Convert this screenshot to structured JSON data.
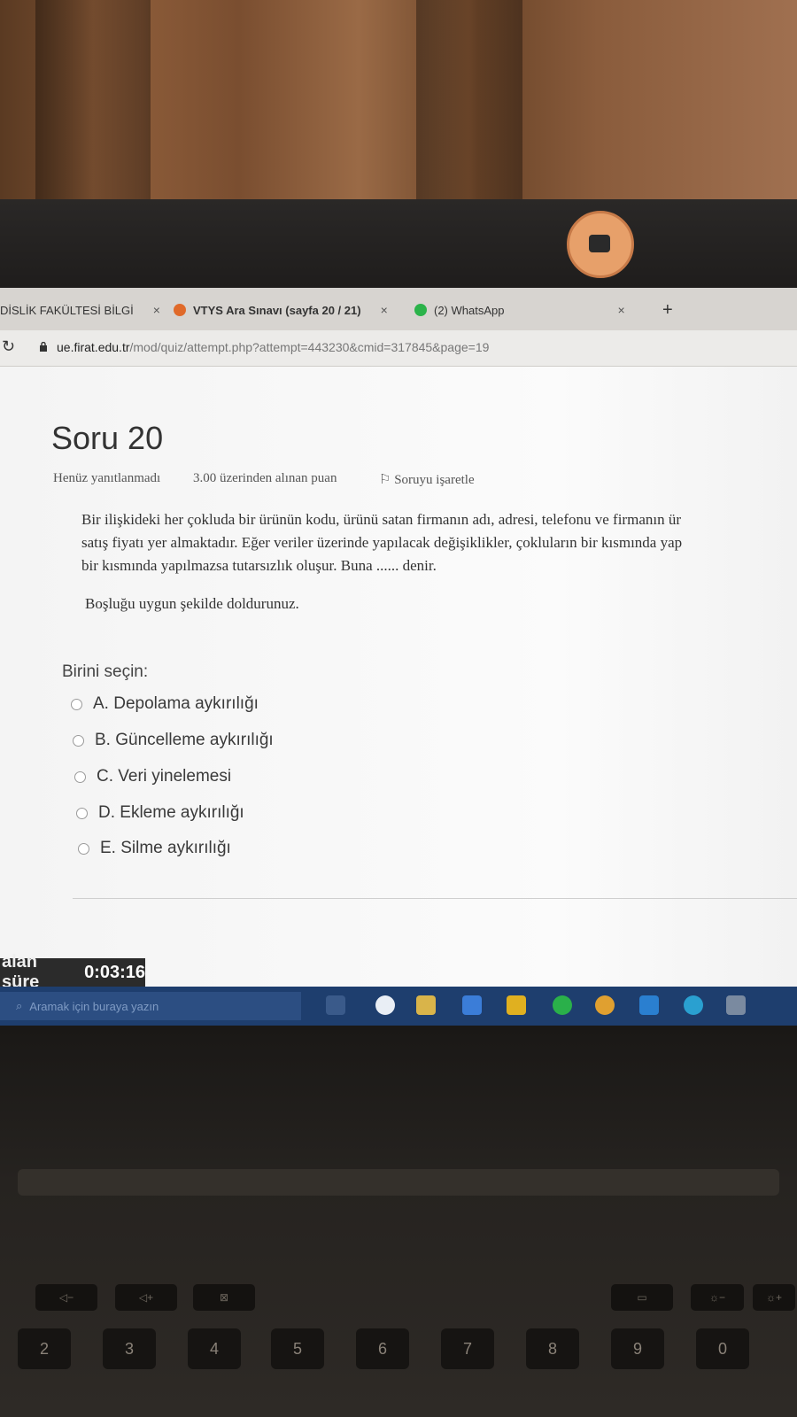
{
  "browser": {
    "tabs": [
      {
        "label": "DİSLİK FAKÜLTESİ BİLGİ",
        "close": "×"
      },
      {
        "label": "VTYS Ara Sınavı (sayfa 20 / 21)",
        "close": "×"
      },
      {
        "label": "(2) WhatsApp",
        "close": "×"
      }
    ],
    "new_tab": "+",
    "url_host": "ue.firat.edu.tr",
    "url_path": "/mod/quiz/attempt.php?attempt=443230&cmid=317845&page=19"
  },
  "question": {
    "title": "Soru 20",
    "status": "Henüz yanıtlanmadı",
    "points": "3.00 üzerinden alınan puan",
    "flag": "Soruyu işaretle",
    "text_lines": [
      "Bir ilişkideki her çokluda bir ürünün kodu, ürünü satan firmanın adı, adresi, telefonu ve firmanın ür",
      "satış fiyatı yer almaktadır. Eğer veriler üzerinde yapılacak değişiklikler, çokluların bir kısmında yap",
      "bir kısmında yapılmazsa tutarsızlık oluşur. Buna ...... denir."
    ],
    "prompt": "Boşluğu uygun şekilde doldurunuz.",
    "choose_label": "Birini seçin:",
    "options": [
      "A. Depolama aykırılığı",
      "B. Güncelleme aykırılığı",
      "C. Veri yinelemesi",
      "D. Ekleme aykırılığı",
      "E. Silme aykırılığı"
    ]
  },
  "timer": {
    "label": "alan süre",
    "value": "0:03:16"
  },
  "taskbar": {
    "search_placeholder": "Aramak için buraya yazın"
  },
  "keyboard": {
    "number_keys": [
      "2",
      "3",
      "4",
      "5",
      "6",
      "7",
      "8",
      "9",
      "0"
    ],
    "symbol_keys": [
      "#",
      "$",
      "%",
      "&",
      "/",
      "(",
      ")",
      "="
    ]
  },
  "colors": {
    "taskbar": "#1e3e6e",
    "page_bg": "#f7f7f7",
    "timer_bg": "#2b2b2b"
  }
}
